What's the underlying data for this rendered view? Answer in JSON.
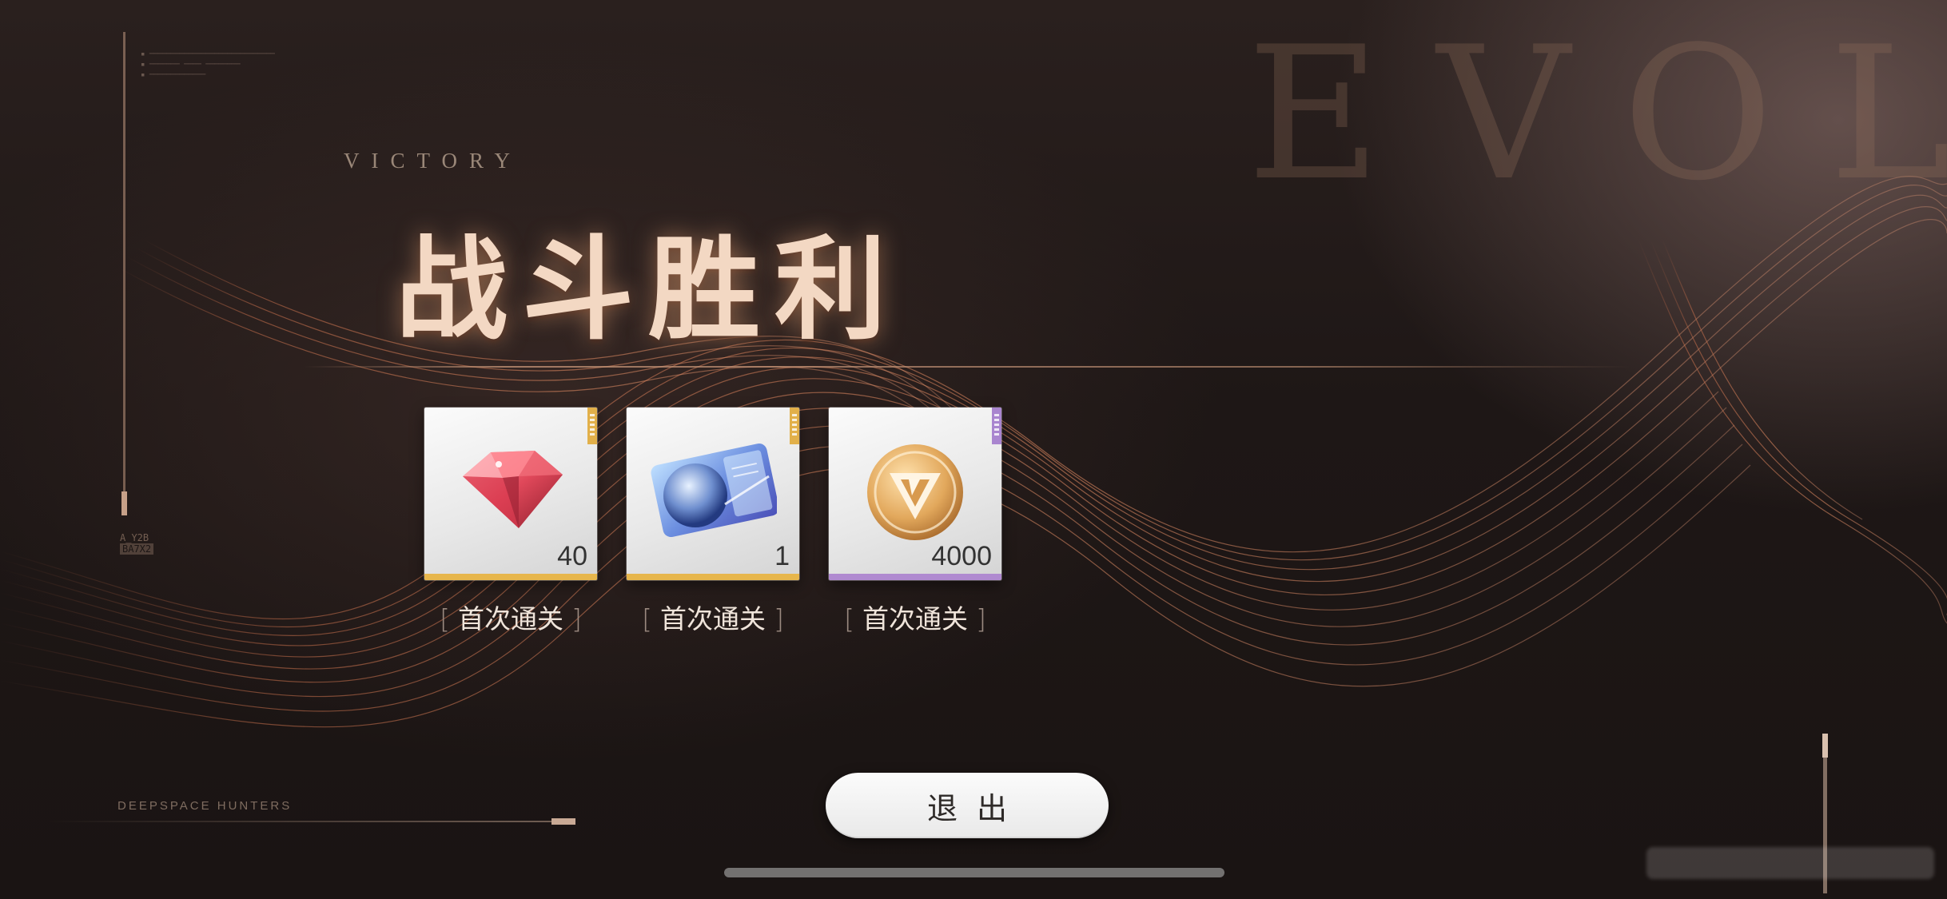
{
  "background": {
    "watermark_word": "EVOL"
  },
  "header": {
    "subtitle": "VICTORY",
    "title": "战斗胜利"
  },
  "rewards": [
    {
      "icon": "red-diamond-icon",
      "amount": "40",
      "label": "首次通关",
      "bar_color": "#e7b64c",
      "tag_color": "#e2b04a"
    },
    {
      "icon": "blue-ticket-icon",
      "amount": "1",
      "label": "首次通关",
      "bar_color": "#e7b64c",
      "tag_color": "#e2b04a"
    },
    {
      "icon": "gold-coin-icon",
      "amount": "4000",
      "label": "首次通关",
      "bar_color": "#b08ad0",
      "tag_color": "#a985cf"
    }
  ],
  "exit_button": {
    "label": "退出"
  },
  "footer": {
    "brand": "DEEPSPACE HUNTERS"
  }
}
